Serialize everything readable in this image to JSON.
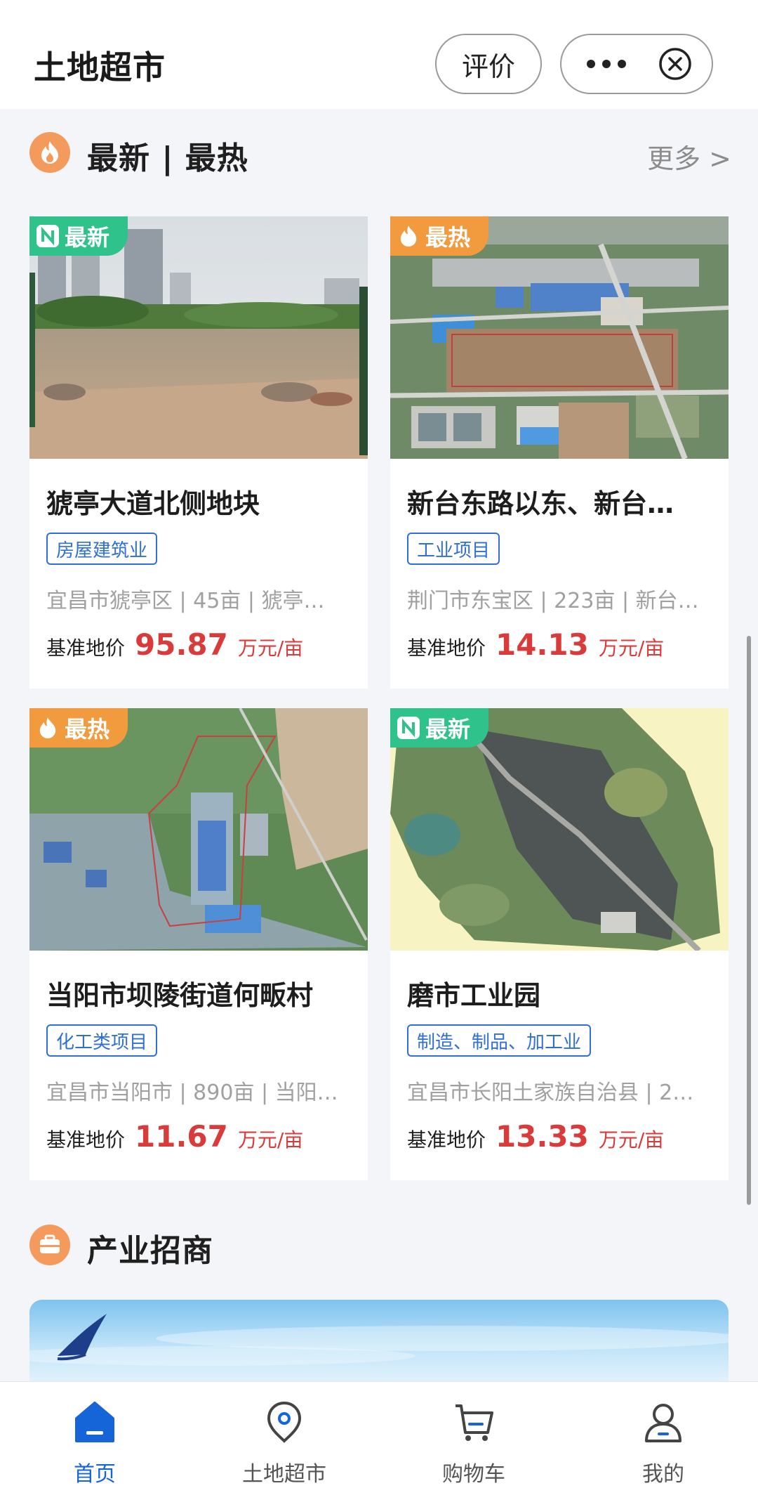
{
  "header": {
    "title": "土地超市",
    "rate_label": "评价"
  },
  "section_latest": {
    "title": "最新 | 最热",
    "more_label": "更多 >"
  },
  "cards": [
    {
      "badge": "最新",
      "badge_kind": "new",
      "title": "猇亭大道北侧地块",
      "tag": "房屋建筑业",
      "meta": "宜昌市猇亭区 | 45亩 | 猇亭…",
      "price_label": "基准地价",
      "price": "95.87",
      "unit": "万元/亩"
    },
    {
      "badge": "最热",
      "badge_kind": "hot",
      "title": "新台东路以东、新台…",
      "tag": "工业项目",
      "meta": "荆门市东宝区 | 223亩 | 新台…",
      "price_label": "基准地价",
      "price": "14.13",
      "unit": "万元/亩"
    },
    {
      "badge": "最热",
      "badge_kind": "hot",
      "title": "当阳市坝陵街道何畈村",
      "tag": "化工类项目",
      "meta": "宜昌市当阳市 | 890亩 | 当阳…",
      "price_label": "基准地价",
      "price": "11.67",
      "unit": "万元/亩"
    },
    {
      "badge": "最新",
      "badge_kind": "new",
      "title": "磨市工业园",
      "tag": "制造、制品、加工业",
      "meta": "宜昌市长阳土家族自治县 | 2…",
      "price_label": "基准地价",
      "price": "13.33",
      "unit": "万元/亩"
    }
  ],
  "section_industry": {
    "title": "产业招商"
  },
  "tabbar": {
    "items": [
      {
        "label": "首页",
        "icon": "home-icon",
        "active": true
      },
      {
        "label": "土地超市",
        "icon": "location-pin-icon",
        "active": false
      },
      {
        "label": "购物车",
        "icon": "cart-icon",
        "active": false
      },
      {
        "label": "我的",
        "icon": "user-icon",
        "active": false
      }
    ]
  },
  "colors": {
    "accent": "#1565d8",
    "price": "#d93b3b",
    "badge_new": "#2fc28a",
    "badge_hot": "#f19a3e",
    "section_icon": "#f39a5c",
    "tag_border": "#2f6fd6"
  }
}
